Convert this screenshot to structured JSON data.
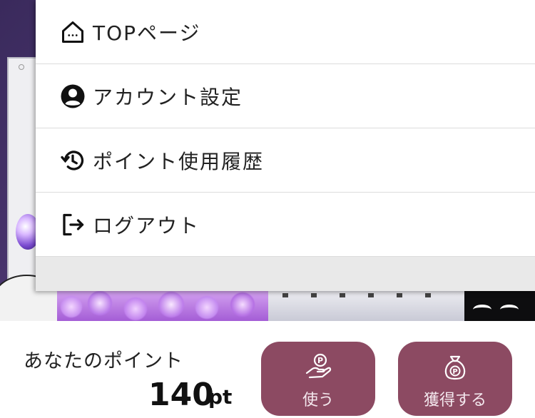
{
  "menu": {
    "items": [
      {
        "label": "TOPページ",
        "icon": "home-icon"
      },
      {
        "label": "アカウント設定",
        "icon": "account-circle-icon"
      },
      {
        "label": "ポイント使用履歴",
        "icon": "history-icon"
      },
      {
        "label": "ログアウト",
        "icon": "logout-icon"
      }
    ]
  },
  "points": {
    "caption": "あなたのポイント",
    "value": "140",
    "unit": "pt"
  },
  "actions": {
    "use_label": "使う",
    "use_icon": "hand-coin-icon",
    "earn_label": "獲得する",
    "earn_icon": "money-bag-icon"
  },
  "colors": {
    "button_bg": "#8c4a62",
    "menu_bg": "#ffffff",
    "divider": "#dcdcdc"
  }
}
